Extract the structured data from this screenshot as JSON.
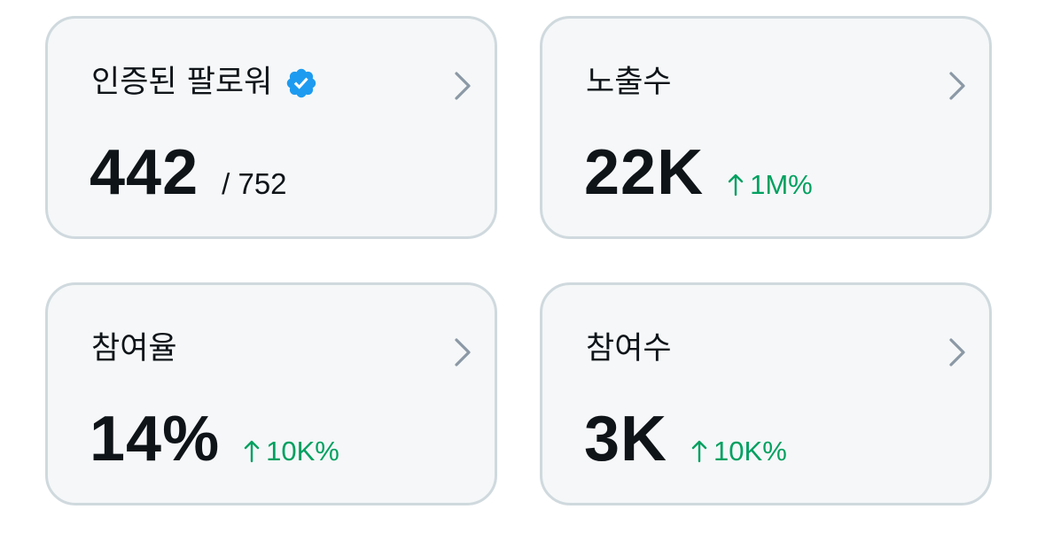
{
  "colors": {
    "card_bg": "#f5f7f8",
    "card_border": "#cfd9de",
    "text_primary": "#0f1419",
    "chevron": "#8b98a5",
    "positive": "#00a060",
    "verified": "#1d9bf0"
  },
  "cards": [
    {
      "title": "인증된 팔로워",
      "title_icon": "verified-badge-icon",
      "value": "442",
      "total": "/ 752",
      "action_icon": "chevron-right-icon"
    },
    {
      "title": "노출수",
      "value": "22K",
      "change_icon": "arrow-up-icon",
      "change": "1M%",
      "action_icon": "chevron-right-icon"
    },
    {
      "title": "참여율",
      "value": "14%",
      "change_icon": "arrow-up-icon",
      "change": "10K%",
      "action_icon": "chevron-right-icon"
    },
    {
      "title": "참여수",
      "value": "3K",
      "change_icon": "arrow-up-icon",
      "change": "10K%",
      "action_icon": "chevron-right-icon"
    }
  ]
}
